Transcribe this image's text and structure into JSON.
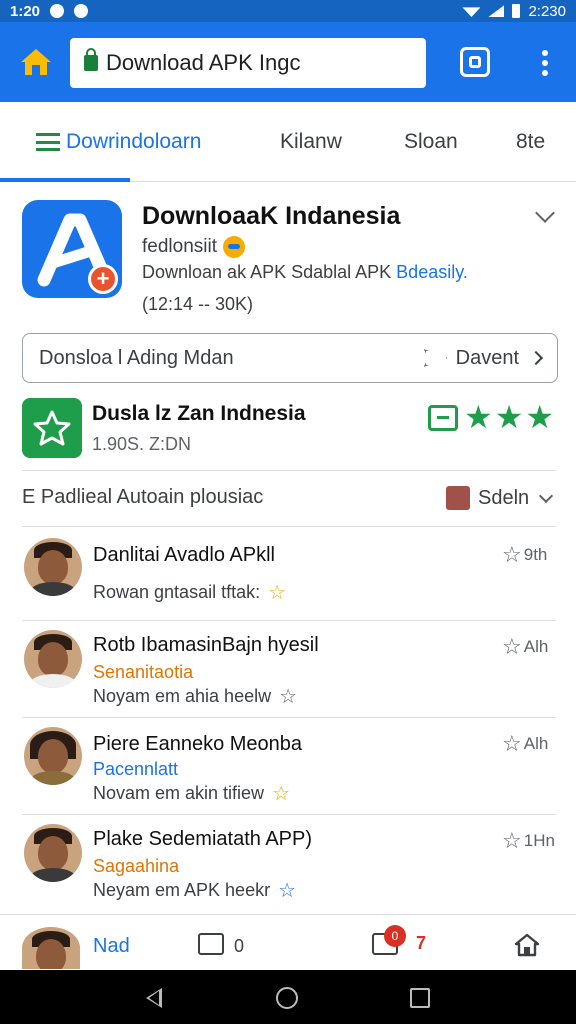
{
  "status_bar": {
    "time": "1:20",
    "clock_right": "2:230"
  },
  "browser": {
    "url_text": "Download APK Ingc",
    "icons": [
      "home-icon",
      "lock-icon",
      "tabs-icon",
      "more-icon"
    ]
  },
  "tabs": [
    {
      "label": "Dowrindoloarn",
      "active": true
    },
    {
      "label": "Kilanw",
      "active": false
    },
    {
      "label": "Sloan",
      "active": false
    },
    {
      "label": "8te",
      "active": false
    }
  ],
  "app": {
    "title": "DownloaaK Indanesia",
    "subtitle": "fedlonsiit",
    "desc_prefix": "Downloan ak APK Sdablal APK ",
    "desc_link": "Bdeasily.",
    "meta": "(12:14 -- 30K)",
    "pill_left": "Donsloa l Ading Mdan",
    "pill_right": "Davent"
  },
  "app2": {
    "title": "Dusla lz Zan Indnesia",
    "size": "1.90S. Z:DN",
    "stars": "★★★",
    "star_count": 3
  },
  "filter": {
    "label": "E Padlieal Autoain plousiac",
    "sort_label": "Sdeln"
  },
  "reviews": [
    {
      "name": "Danlitai Avadlo APkll",
      "tag": "",
      "text": "Rowan gntasail tftak:",
      "time": "9th",
      "star": "☆",
      "star_color": "#f9ab00"
    },
    {
      "name": "Rotb IbamasinBajn hyesil",
      "tag": "Senanitaotia",
      "tag_color": "#e37400",
      "text": "Noyam em ahia heelw",
      "time": "Alh",
      "star": "☆",
      "star_color": "#5f6368"
    },
    {
      "name": "Piere Eanneko Meonba",
      "tag": "Pacennlatt",
      "tag_color": "#1a73e8",
      "text": "Novam em akin tifiew",
      "time": "Alh",
      "star": "☆",
      "star_color": "#f9ab00"
    },
    {
      "name": "Plake Sedemiatath APP)",
      "tag": "Sagaahina",
      "tag_color": "#e37400",
      "text": "Neyam em APK heekr",
      "time": "1Hn",
      "star": "☆",
      "star_color": "#1a73e8"
    }
  ],
  "bottom_bar": {
    "name": "Nad",
    "chat_count": "0",
    "notif_badge": "0",
    "notif_count": "7"
  },
  "colors": {
    "brand": "#1a73e8",
    "green": "#1e9e4a",
    "red": "#d93025"
  }
}
